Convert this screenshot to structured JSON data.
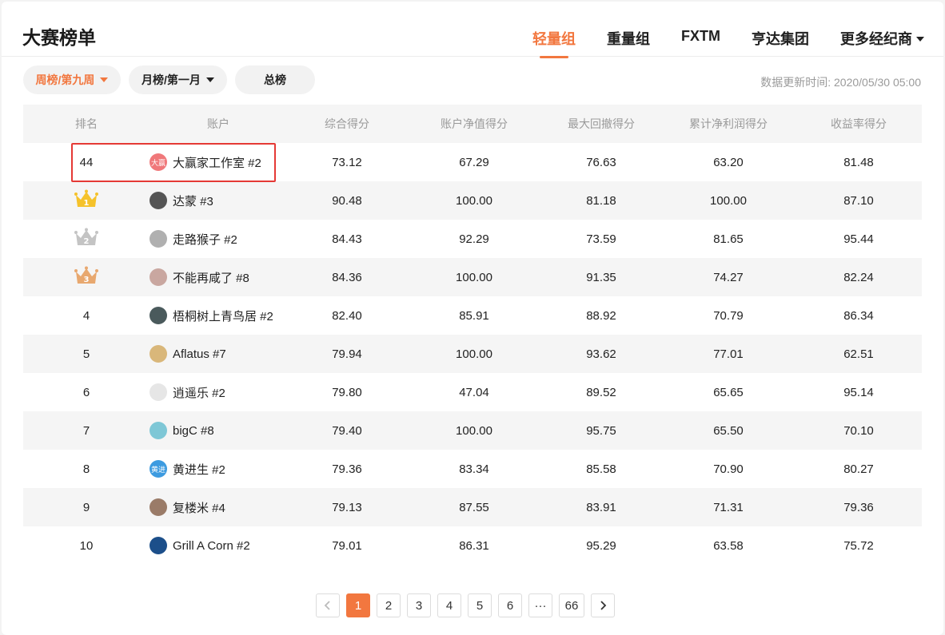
{
  "header": {
    "title": "大赛榜单",
    "tabs": [
      {
        "label": "轻量组",
        "active": true
      },
      {
        "label": "重量组",
        "active": false
      },
      {
        "label": "FXTM",
        "active": false
      },
      {
        "label": "亨达集团",
        "active": false
      },
      {
        "label": "更多经纪商",
        "active": false,
        "dropdown": true
      }
    ]
  },
  "filters": {
    "weekly": "周榜/第九周",
    "monthly": "月榜/第一月",
    "overall": "总榜",
    "update_time": "数据更新时间: 2020/05/30 05:00"
  },
  "table": {
    "columns": [
      "排名",
      "账户",
      "综合得分",
      "账户净值得分",
      "最大回撤得分",
      "累计净利润得分",
      "收益率得分"
    ],
    "rows": [
      {
        "rank": "44",
        "crown": "",
        "name": "大赢家工作室 #2",
        "avatar_text": "大赢",
        "avatar_color": "#f0787a",
        "s1": "73.12",
        "s2": "67.29",
        "s3": "76.63",
        "s4": "63.20",
        "s5": "81.48"
      },
      {
        "rank": "1",
        "crown": "gold",
        "name": "达蒙 #3",
        "avatar_text": "",
        "avatar_color": "#555555",
        "s1": "90.48",
        "s2": "100.00",
        "s3": "81.18",
        "s4": "100.00",
        "s5": "87.10"
      },
      {
        "rank": "2",
        "crown": "silver",
        "name": "走路猴子 #2",
        "avatar_text": "",
        "avatar_color": "#b0b0b0",
        "s1": "84.43",
        "s2": "92.29",
        "s3": "73.59",
        "s4": "81.65",
        "s5": "95.44"
      },
      {
        "rank": "3",
        "crown": "bronze",
        "name": "不能再咸了 #8",
        "avatar_text": "",
        "avatar_color": "#c9a7a0",
        "s1": "84.36",
        "s2": "100.00",
        "s3": "91.35",
        "s4": "74.27",
        "s5": "82.24"
      },
      {
        "rank": "4",
        "crown": "",
        "name": "梧桐树上青鸟居 #2",
        "avatar_text": "",
        "avatar_color": "#4a5a5c",
        "s1": "82.40",
        "s2": "85.91",
        "s3": "88.92",
        "s4": "70.79",
        "s5": "86.34"
      },
      {
        "rank": "5",
        "crown": "",
        "name": "Aflatus #7",
        "avatar_text": "",
        "avatar_color": "#d9b77a",
        "s1": "79.94",
        "s2": "100.00",
        "s3": "93.62",
        "s4": "77.01",
        "s5": "62.51"
      },
      {
        "rank": "6",
        "crown": "",
        "name": "逍遥乐 #2",
        "avatar_text": "",
        "avatar_color": "#e6e6e6",
        "s1": "79.80",
        "s2": "47.04",
        "s3": "89.52",
        "s4": "65.65",
        "s5": "95.14"
      },
      {
        "rank": "7",
        "crown": "",
        "name": "bigC #8",
        "avatar_text": "",
        "avatar_color": "#7ec7d6",
        "s1": "79.40",
        "s2": "100.00",
        "s3": "95.75",
        "s4": "65.50",
        "s5": "70.10"
      },
      {
        "rank": "8",
        "crown": "",
        "name": "黄进生 #2",
        "avatar_text": "黄进",
        "avatar_color": "#3d9be0",
        "s1": "79.36",
        "s2": "83.34",
        "s3": "85.58",
        "s4": "70.90",
        "s5": "80.27"
      },
      {
        "rank": "9",
        "crown": "",
        "name": "复楼米 #4",
        "avatar_text": "",
        "avatar_color": "#9a7b68",
        "s1": "79.13",
        "s2": "87.55",
        "s3": "83.91",
        "s4": "71.31",
        "s5": "79.36"
      },
      {
        "rank": "10",
        "crown": "",
        "name": "Grill A Corn #2",
        "avatar_text": "",
        "avatar_color": "#1c4f8a",
        "s1": "79.01",
        "s2": "86.31",
        "s3": "95.29",
        "s4": "63.58",
        "s5": "75.72"
      }
    ]
  },
  "pagination": {
    "prev_icon": "chevron-left-icon",
    "next_icon": "chevron-right-icon",
    "pages": [
      "1",
      "2",
      "3",
      "4",
      "5",
      "6",
      "···",
      "66"
    ],
    "current": "1"
  },
  "colors": {
    "accent": "#f2773f",
    "highlight_box": "#e53935",
    "crown_gold": "#f5c22b",
    "crown_silver": "#c4c4c4",
    "crown_bronze": "#e8a86f"
  }
}
